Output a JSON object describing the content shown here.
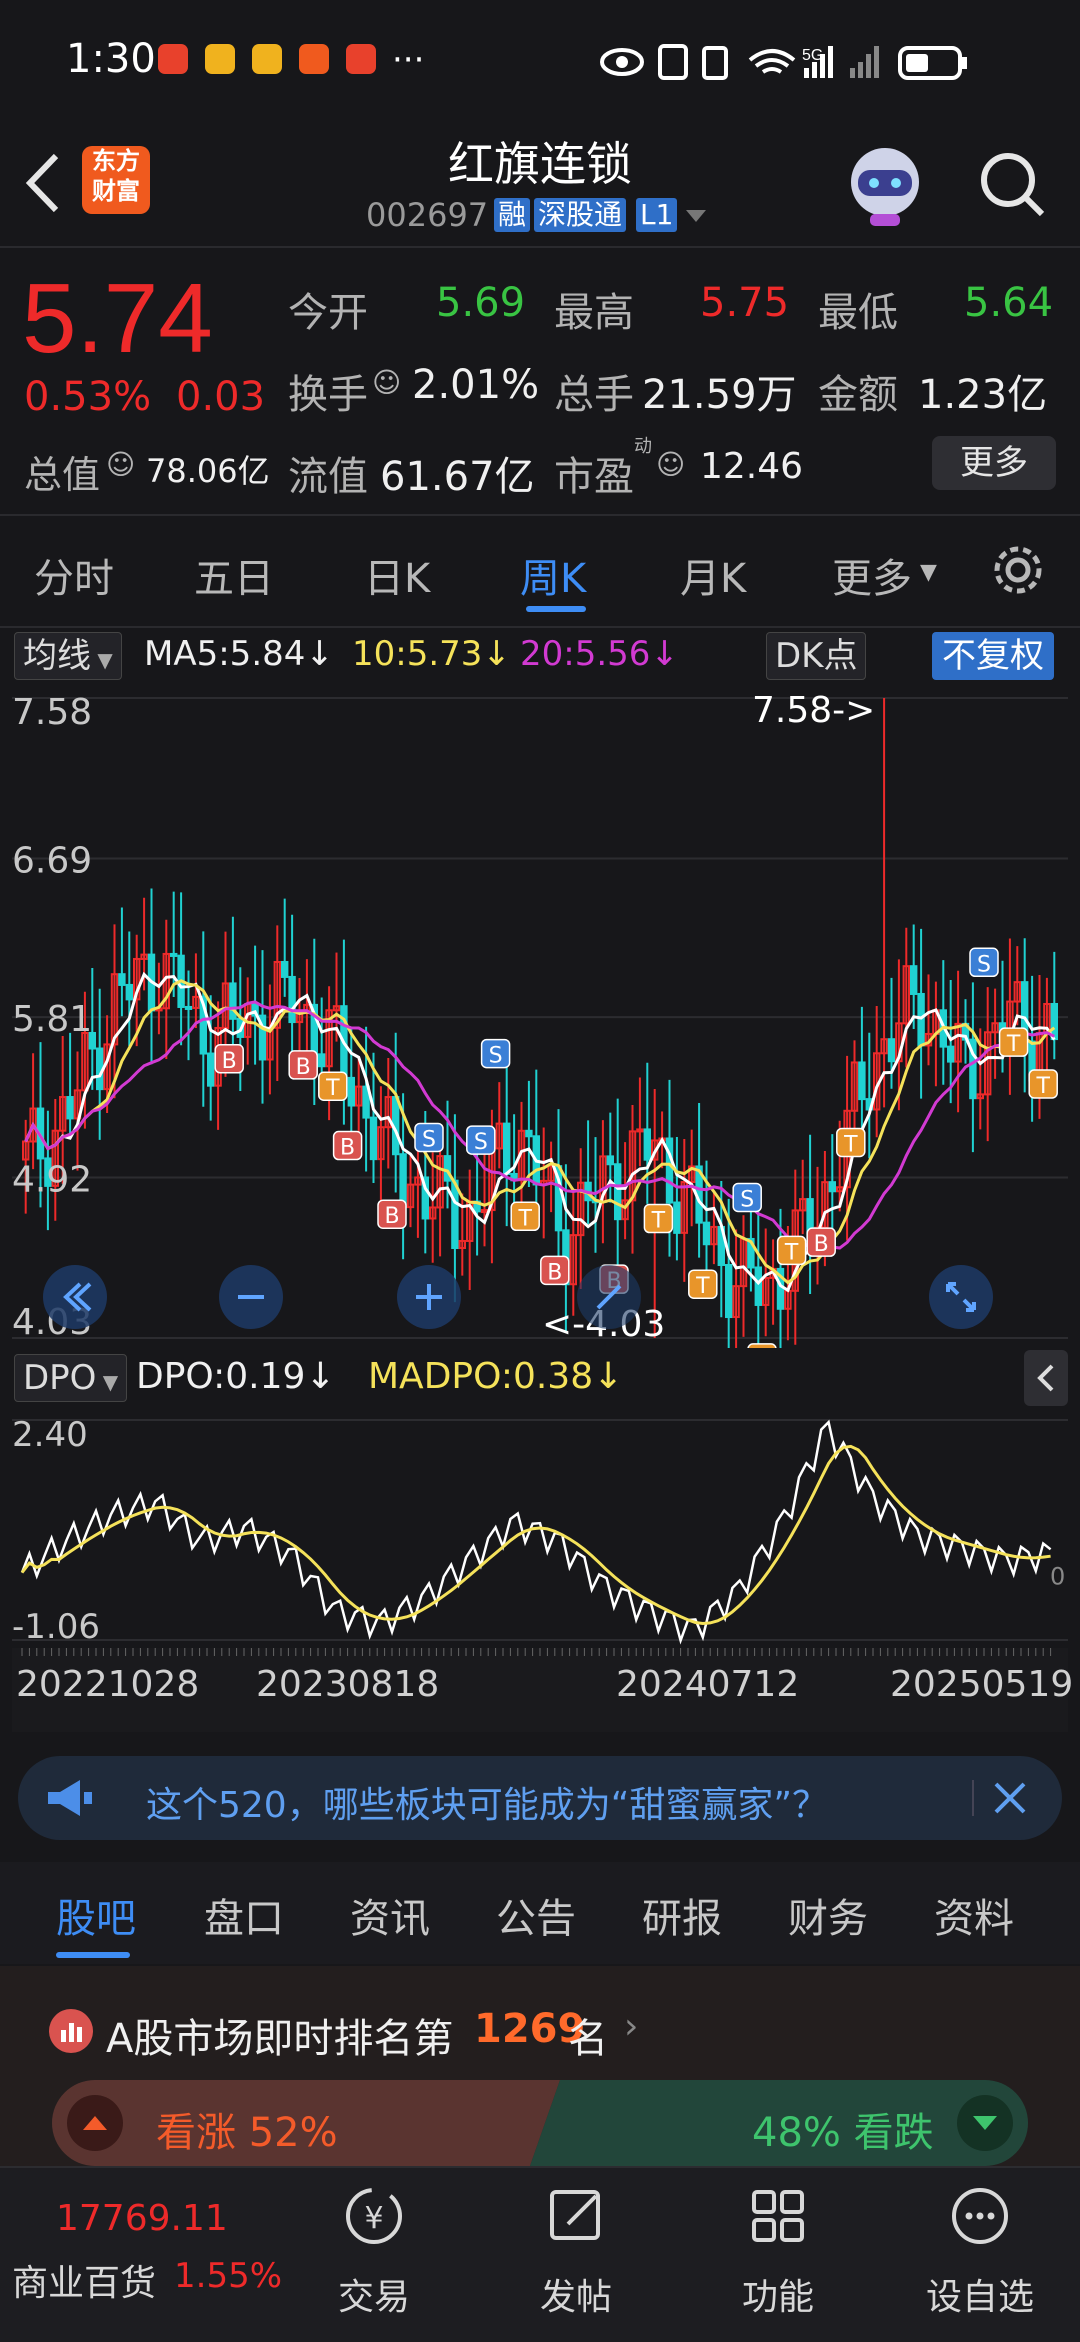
{
  "status_bar": {
    "time": "1:30",
    "more": "···"
  },
  "header": {
    "title": "红旗连锁",
    "code": "002697",
    "tags": [
      "融",
      "深股通",
      "L1"
    ],
    "logo_text": [
      "东方",
      "财富"
    ]
  },
  "quote": {
    "price": "5.74",
    "change_pct": "0.53%",
    "change_abs": "0.03",
    "open_label": "今开",
    "open": "5.69",
    "high_label": "最高",
    "high": "5.75",
    "low_label": "最低",
    "low": "5.64",
    "turnover_label": "换手",
    "turnover": "2.01%",
    "volume_label": "总手",
    "volume": "21.59万",
    "amount_label": "金额",
    "amount": "1.23亿",
    "mcap_label": "总值",
    "mcap": "78.06亿",
    "float_label": "流值",
    "float": "61.67亿",
    "pe_label": "市盈",
    "pe_sup": "动",
    "pe": "12.46",
    "more_label": "更多"
  },
  "period_tabs": [
    "分时",
    "五日",
    "日K",
    "周K",
    "月K",
    "更多"
  ],
  "active_period": "周K",
  "chart_toolbar": {
    "indicator": "均线",
    "ma5": "MA5:5.84↓",
    "ma10": "10:5.73↓",
    "ma20": "20:5.56↓",
    "dk_label": "DK点",
    "adjust_label": "不复权"
  },
  "sub_toolbar": {
    "indicator": "DPO",
    "dpo": "DPO:0.19↓",
    "madpo": "MADPO:0.38↓"
  },
  "chart_data": [
    {
      "type": "candlestick",
      "y_ticks": [
        "7.58",
        "6.69",
        "5.81",
        "4.92",
        "4.03"
      ],
      "ylim": [
        4.03,
        7.58
      ],
      "max_annotation": "7.58->",
      "min_annotation": "<-4.03",
      "series": [
        {
          "name": "MA5",
          "color": "#ffffff"
        },
        {
          "name": "MA10",
          "color": "#f5e25a"
        },
        {
          "name": "MA20",
          "color": "#d23ad2"
        }
      ],
      "markers": {
        "buy": "B",
        "sell": "S",
        "t": "T"
      }
    },
    {
      "type": "line",
      "y_ticks": [
        "2.40",
        "-1.06"
      ],
      "ylim": [
        -1.06,
        2.4
      ],
      "right_label": "0",
      "series": [
        {
          "name": "DPO",
          "color": "#ffffff"
        },
        {
          "name": "MADPO",
          "color": "#f5e25a"
        }
      ],
      "x_labels": [
        "20221028",
        "20230818",
        "20240712",
        "20250519"
      ]
    }
  ],
  "banner": {
    "text": "这个520，哪些板块可能成为“甜蜜赢家”？"
  },
  "bottom_tabs": [
    "股吧",
    "盘口",
    "资讯",
    "公告",
    "研报",
    "财务",
    "资料"
  ],
  "active_bottom_tab": "股吧",
  "rank": {
    "prefix": "A股市场即时排名第",
    "number": "1269",
    "suffix": "名",
    "up_label": "看涨 52%",
    "down_label": "48% 看跌"
  },
  "nav": {
    "index_value": "17769.11",
    "index_name": "商业百货",
    "index_change": "1.55%",
    "items": [
      "交易",
      "发帖",
      "功能",
      "设自选"
    ],
    "trade_icon_glyph": "¥"
  }
}
